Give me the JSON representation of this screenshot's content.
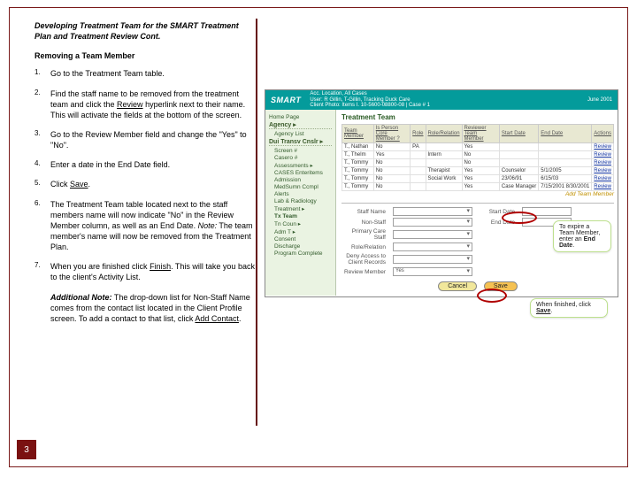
{
  "title": "Developing Treatment Team for the SMART Treatment Plan and Treatment Review Cont.",
  "subhead": "Removing a Team Member",
  "steps": {
    "s1": "Go to the Treatment Team table.",
    "s2_a": "Find the staff name to be removed from the treatment team and click the ",
    "s2_u": "Review",
    "s2_b": " hyperlink next to their name. This will activate the fields at the bottom of the screen.",
    "s3": "Go to the Review Member field and change the \"Yes\" to \"No\".",
    "s4": "Enter a date in the End Date field.",
    "s5_a": "Click ",
    "s5_u": "Save",
    "s5_b": ".",
    "s6_a": "The Treatment Team table located next to the staff members name will now indicate \"No\" in the Review Member column, as well as an End Date. ",
    "s6_note": "Note:",
    "s6_b": " The team member's name will now be removed from the Treatment Plan.",
    "s7_a": "When you are finished click ",
    "s7_u": "Finish",
    "s7_b": ". This will take you back to the client's Activity List."
  },
  "addl_label": "Additional Note:",
  "addl_a": " The drop-down list for Non-Staff Name comes from the contact list located in the Client Profile screen. To add a contact to that list, click ",
  "addl_u": "Add Contact",
  "addl_b": ".",
  "page_number": "3",
  "app": {
    "logo": "SMART",
    "header_line1": "Acc. Location, All Cases",
    "header_line2": "User: R Gillin, T-Gillin, Tracking Duck Care",
    "header_line3": "Client Photo: Items I. 10-5600-08800-08 | Case # 1",
    "date": "June 2001"
  },
  "nav": {
    "home": "Home Page",
    "agency_hdr": "Agency ▸",
    "agency_list": "Agency List",
    "dui_hdr": "Dui Transv Cnslr ▸",
    "screen": "Screen #",
    "casero": "Casero #",
    "assess": "Assessments ▸",
    "cases": "CASES Enteritems",
    "admin": "Admission",
    "medsum": "MedSumn Ccmpl",
    "alerts": "Alerts",
    "lab": "Lab & Radiology",
    "tx": "Treatment ▸",
    "txteam": "Tx Team",
    "tncoun": "Tn Coun ▸",
    "adm": "Adm T ▸",
    "consent": "Consent",
    "discharge": "Discharge",
    "progcomp": "Program Complete"
  },
  "table": {
    "title": "Treatment Team",
    "cols": [
      "Team Member",
      "Is Person Core Member ?",
      "Role",
      "Role/Relation",
      "Reviewer Team Member",
      "Start Date",
      "End Date",
      "Actions"
    ],
    "rows": [
      [
        "T., Nathan",
        "No",
        "PA",
        "",
        "Yes",
        "",
        "",
        "Review"
      ],
      [
        "T., Thelm",
        "Yes",
        "",
        "Intern",
        "No",
        "",
        "",
        "Review"
      ],
      [
        "T., Tommy",
        "No",
        "",
        "",
        "No",
        "",
        "",
        "Review"
      ],
      [
        "T., Tommy",
        "No",
        "",
        "Therapist",
        "Yes",
        "Counselor",
        "5/1/2005",
        "Review"
      ],
      [
        "T., Tommy",
        "No",
        "",
        "Social Work",
        "Yes",
        "23/06/91",
        "6/15/03",
        "Review"
      ],
      [
        "T., Tommy",
        "No",
        "",
        "",
        "Yes",
        "Case Manager",
        "7/15/2001  8/30/2001",
        "Review"
      ]
    ]
  },
  "form": {
    "staff_name": "Staff Name",
    "non_staff": "Non-Staff",
    "primary_care": "Primary Care Staff",
    "role_relation": "Role/Relation",
    "deny": "Deny Access to Client Records",
    "review_member": "Review Member",
    "yes": "Yes",
    "start_date": "Start Date",
    "end_date": "End Date",
    "add_link": "Add Team Member",
    "btn_cancel": "Cancel",
    "btn_save": "Save"
  },
  "callouts": {
    "expire_a": "To expire a Team Member, enter an ",
    "expire_b": "End Date",
    "expire_c": ".",
    "finish_a": "When finished, click ",
    "finish_b": "Save",
    "finish_c": "."
  }
}
